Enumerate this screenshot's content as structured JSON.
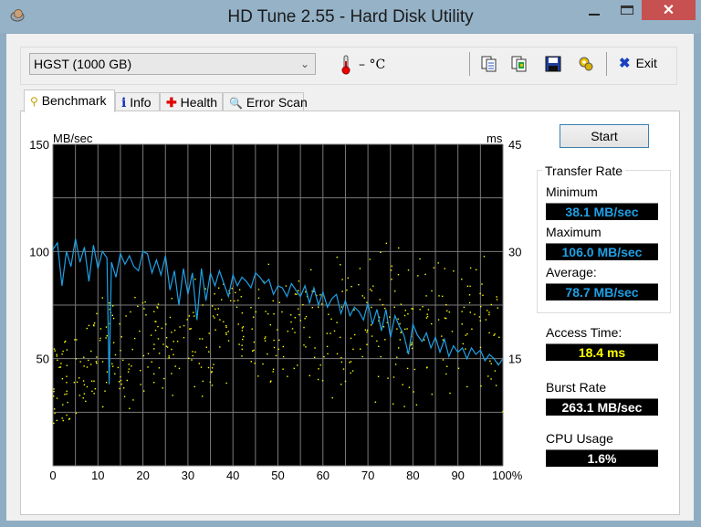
{
  "window": {
    "title": "HD Tune 2.55 - Hard Disk Utility",
    "controls": {
      "minimize": "minimize",
      "maximize": "maximize",
      "close": "✕"
    }
  },
  "toolbar": {
    "drive": "HGST (1000 GB)",
    "temperature": "– °C",
    "icons": [
      "copy-text-icon",
      "copy-image-icon",
      "save-icon",
      "options-icon"
    ],
    "exit_label": "Exit"
  },
  "tabs": [
    {
      "label": "Benchmark",
      "icon": "bulb-icon",
      "active": true
    },
    {
      "label": "Info",
      "icon": "info-icon",
      "active": false
    },
    {
      "label": "Health",
      "icon": "health-cross-icon",
      "active": false
    },
    {
      "label": "Error Scan",
      "icon": "magnifier-icon",
      "active": false
    }
  ],
  "benchmark": {
    "start_label": "Start",
    "transfer_rate": {
      "title": "Transfer Rate",
      "minimum_label": "Minimum",
      "minimum": "38.1 MB/sec",
      "maximum_label": "Maximum",
      "maximum": "106.0 MB/sec",
      "average_label": "Average:",
      "average": "78.7 MB/sec"
    },
    "access_time_label": "Access Time:",
    "access_time": "18.4 ms",
    "burst_rate_label": "Burst Rate",
    "burst_rate": "263.1 MB/sec",
    "cpu_usage_label": "CPU Usage",
    "cpu_usage": "1.6%",
    "colors": {
      "transfer": "#1ea0e6",
      "access": "#ffff00",
      "burst": "#ffffff",
      "bg": "#000000",
      "grid": "#808080"
    }
  },
  "chart_data": {
    "type": "line",
    "title": "",
    "xlabel": "",
    "ylabel": "MB/sec",
    "y2label": "ms",
    "xlim": [
      0,
      100
    ],
    "ylim": [
      0,
      150
    ],
    "y2lim": [
      0,
      45
    ],
    "x_ticks": [
      "0",
      "10",
      "20",
      "30",
      "40",
      "50",
      "60",
      "70",
      "80",
      "90",
      "100%"
    ],
    "y_ticks": [
      "150",
      "100",
      "50"
    ],
    "y_tick_values": [
      150,
      100,
      50
    ],
    "y2_ticks": [
      "45",
      "30",
      "15"
    ],
    "y2_tick_values": [
      45,
      30,
      15
    ],
    "grid": true,
    "series": [
      {
        "name": "Transfer Rate (MB/sec)",
        "axis": "left",
        "x": [
          0,
          1,
          2,
          3,
          4,
          5,
          6,
          7,
          8,
          9,
          10,
          11,
          12,
          12.5,
          13,
          14,
          15,
          16,
          17,
          18,
          19,
          20,
          21,
          22,
          23,
          24,
          25,
          26,
          27,
          28,
          29,
          30,
          31,
          32,
          33,
          34,
          35,
          36,
          37,
          38,
          39,
          40,
          41,
          42,
          43,
          44,
          45,
          46,
          47,
          48,
          49,
          50,
          51,
          52,
          53,
          54,
          55,
          56,
          57,
          58,
          59,
          60,
          61,
          62,
          63,
          64,
          65,
          66,
          67,
          68,
          69,
          70,
          71,
          72,
          73,
          74,
          75,
          76,
          77,
          78,
          79,
          80,
          81,
          82,
          83,
          84,
          85,
          86,
          87,
          88,
          89,
          90,
          91,
          92,
          93,
          94,
          95,
          96,
          97,
          98,
          99,
          100
        ],
        "y": [
          101,
          104,
          84,
          100,
          93,
          106,
          95,
          102,
          86,
          103,
          92,
          100,
          97,
          38,
          95,
          88,
          99,
          94,
          98,
          93,
          91,
          100,
          99,
          90,
          96,
          89,
          98,
          82,
          91,
          75,
          92,
          80,
          90,
          68,
          92,
          77,
          90,
          84,
          91,
          85,
          79,
          89,
          84,
          88,
          86,
          83,
          90,
          88,
          85,
          87,
          80,
          84,
          83,
          79,
          85,
          82,
          79,
          84,
          76,
          83,
          75,
          81,
          74,
          78,
          80,
          71,
          77,
          70,
          74,
          72,
          68,
          76,
          66,
          73,
          63,
          73,
          60,
          70,
          65,
          61,
          52,
          66,
          61,
          58,
          62,
          55,
          60,
          53,
          59,
          51,
          56,
          53,
          55,
          50,
          55,
          52,
          54,
          49,
          52,
          50,
          47,
          50
        ]
      },
      {
        "name": "Access Time (ms)",
        "axis": "right",
        "type": "scatter",
        "summary": "scattered points roughly 6–32 ms, mostly 13–25 ms, rising slightly toward the middle and spreading toward the end"
      }
    ]
  }
}
